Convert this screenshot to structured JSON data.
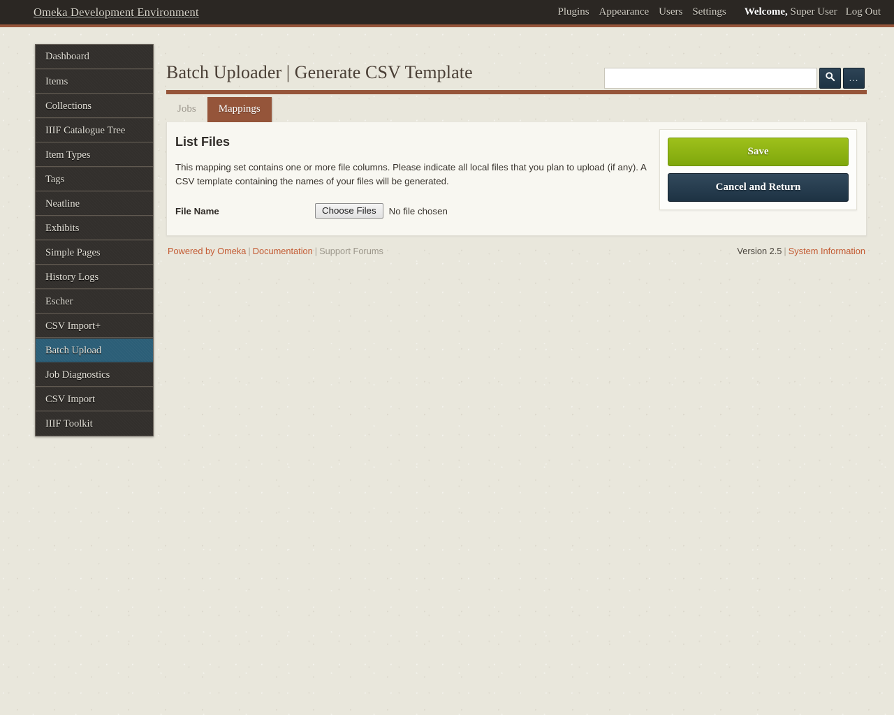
{
  "header": {
    "site_title": "Omeka Development Environment",
    "nav": [
      {
        "label": "Plugins"
      },
      {
        "label": "Appearance"
      },
      {
        "label": "Users"
      },
      {
        "label": "Settings"
      }
    ],
    "welcome_strong": "Welcome,",
    "welcome_user": " Super User",
    "logout_label": "Log Out"
  },
  "sidebar": {
    "items": [
      {
        "label": "Dashboard",
        "active": false
      },
      {
        "label": "Items",
        "active": false
      },
      {
        "label": "Collections",
        "active": false
      },
      {
        "label": "IIIF Catalogue Tree",
        "active": false
      },
      {
        "label": "Item Types",
        "active": false
      },
      {
        "label": "Tags",
        "active": false
      },
      {
        "label": "Neatline",
        "active": false
      },
      {
        "label": "Exhibits",
        "active": false
      },
      {
        "label": "Simple Pages",
        "active": false
      },
      {
        "label": "History Logs",
        "active": false
      },
      {
        "label": "Escher",
        "active": false
      },
      {
        "label": "CSV Import+",
        "active": false
      },
      {
        "label": "Batch Upload",
        "active": true
      },
      {
        "label": "Job Diagnostics",
        "active": false
      },
      {
        "label": "CSV Import",
        "active": false
      },
      {
        "label": "IIIF Toolkit",
        "active": false
      }
    ]
  },
  "page": {
    "title": "Batch Uploader | Generate CSV Template"
  },
  "search": {
    "value": "",
    "placeholder": "",
    "search_icon": "search-icon",
    "advanced_label": "..."
  },
  "tabs": [
    {
      "label": "Jobs",
      "active": false
    },
    {
      "label": "Mappings",
      "active": true
    }
  ],
  "main": {
    "heading": "List Files",
    "intro": "This mapping set contains one or more file columns. Please indicate all local files that you plan to upload (if any). A CSV template containing the names of your files will be generated.",
    "file_label": "File Name",
    "choose_files_label": "Choose Files",
    "no_file_text": "No file chosen"
  },
  "actions": {
    "save_label": "Save",
    "cancel_label": "Cancel and Return"
  },
  "footer": {
    "powered_by": "Powered by Omeka",
    "documentation": "Documentation",
    "support_forums": "Support Forums",
    "version": "Version 2.5",
    "system_information": "System Information",
    "separator": "|"
  },
  "colors": {
    "header_bg": "#2b2723",
    "accent_brown": "#96553a",
    "sidebar_active": "#2b5e77",
    "save_green": "#8eb314",
    "cancel_navy": "#1d3243",
    "link_orange": "#c35a32",
    "body_bg": "#e9e7dc",
    "panel_bg": "#f8f7f1"
  }
}
